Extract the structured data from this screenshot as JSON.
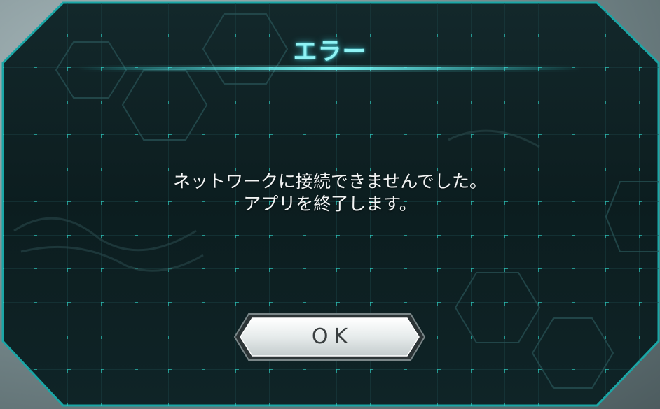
{
  "dialog": {
    "title": "エラー",
    "message_line1": "ネットワークに接続できませんでした。",
    "message_line2": "アプリを終了します。",
    "ok_label": "OK"
  },
  "colors": {
    "panel_bg": "#0f2224",
    "panel_border": "#1aa6a6",
    "grid_line": "#1d4a4c",
    "grid_cross": "#2fd1c6",
    "title_glow": "#8ff3f5",
    "button_face": "#e9eeee"
  }
}
